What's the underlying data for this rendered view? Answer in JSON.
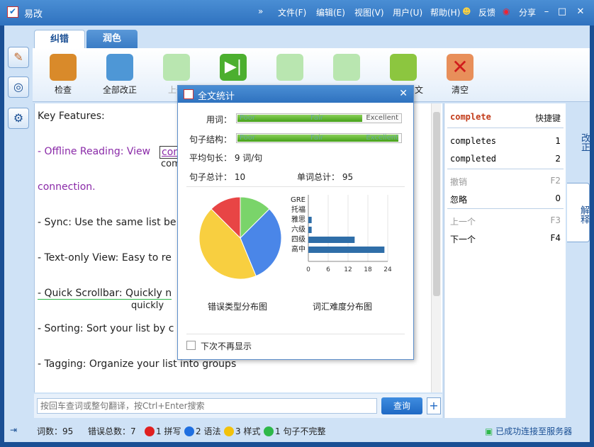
{
  "app": {
    "title": "易改"
  },
  "menu": {
    "expand": "»",
    "file": "文件(F)",
    "edit": "编辑(E)",
    "view": "视图(V)",
    "user": "用户(U)",
    "help": "帮助(H)",
    "feedback": "反馈",
    "share": "分享"
  },
  "tabs": [
    {
      "label": "纠错"
    },
    {
      "label": "润色"
    }
  ],
  "toolbar": [
    {
      "label": "检查",
      "color": "#d98a2a"
    },
    {
      "label": "全部改正",
      "color": "#4e97d6"
    },
    {
      "label": "上一",
      "color": "#b9e6b0"
    },
    {
      "label": "",
      "color": "#4caf2f"
    },
    {
      "label": "",
      "color": "#b9e6b0"
    },
    {
      "label": "",
      "color": "#b9e6b0"
    },
    {
      "label": "文",
      "color": "#8cc63f"
    },
    {
      "label": "清空",
      "color": "#e88f5a"
    }
  ],
  "editor": {
    "lines": [
      "Key Features:",
      "- Offline Reading: View",
      "com",
      "com",
      "connection.",
      "- Sync: Use the same list be",
      "- Text-only View: Easy to re",
      "- Quick Scrollbar: Quickly n",
      "quickly",
      "- Sorting: Sort your list by c",
      "- Tagging: Organize your list into groups"
    ]
  },
  "search": {
    "placeholder": "按回车查词或整句翻译，按Ctrl+Enter搜索",
    "button": "查询",
    "plus": "+"
  },
  "panel": {
    "word": "complete",
    "shortcut_header": "快捷键",
    "suggestions": [
      {
        "text": "completes",
        "key": "1"
      },
      {
        "text": "completed",
        "key": "2"
      }
    ],
    "undo": {
      "label": "撤销",
      "key": "F2"
    },
    "ignore": {
      "label": "忽略",
      "key": "0"
    },
    "prev": {
      "label": "上一个",
      "key": "F3"
    },
    "next": {
      "label": "下一个",
      "key": "F4"
    }
  },
  "vtabs": [
    {
      "label": "改正"
    },
    {
      "label": "解释"
    }
  ],
  "status": {
    "words": "词数：95",
    "errors": "错误总数：7",
    "spell": {
      "label": "1 拼写",
      "color": "#e02020"
    },
    "grammar": {
      "label": "2 语法",
      "color": "#1f6fe0"
    },
    "style": {
      "label": "3 样式",
      "color": "#f2c20c"
    },
    "incomplete": {
      "label": "1 句子不完整",
      "color": "#2eb84a"
    },
    "server": "已成功连接至服务器"
  },
  "dialog": {
    "title": "全文统计",
    "word_label": "用词：",
    "sentence_label": "句子结构：",
    "levels": [
      "Poor",
      "Fair",
      "Excellent"
    ],
    "word_score": 0.76,
    "sentence_score": 0.99,
    "avg_length": "平均句长： 9 词/句",
    "sentence_total": "句子总计： 10",
    "word_total": "单词总计： 95",
    "pie_caption": "错误类型分布图",
    "bar_caption": "词汇难度分布图",
    "dont_show": "下次不再显示"
  },
  "chart_data": [
    {
      "type": "pie",
      "title": "错误类型分布图",
      "slices": [
        {
          "label": "",
          "value": 1,
          "color": "#e84545"
        },
        {
          "label": "",
          "value": 1,
          "color": "#7ad46a"
        },
        {
          "label": "",
          "value": 2.5,
          "color": "#4a86e8"
        },
        {
          "label": "",
          "value": 3.5,
          "color": "#f8cf40"
        }
      ]
    },
    {
      "type": "bar",
      "title": "词汇难度分布图",
      "orientation": "horizontal",
      "categories": [
        "GRE",
        "托福",
        "雅思",
        "六级",
        "四级",
        "高中"
      ],
      "values": [
        0,
        0,
        1,
        1,
        14,
        23
      ],
      "xticks": [
        0,
        6,
        12,
        18,
        24
      ],
      "xlim": [
        0,
        24
      ],
      "color": "#2f6ea8"
    }
  ]
}
